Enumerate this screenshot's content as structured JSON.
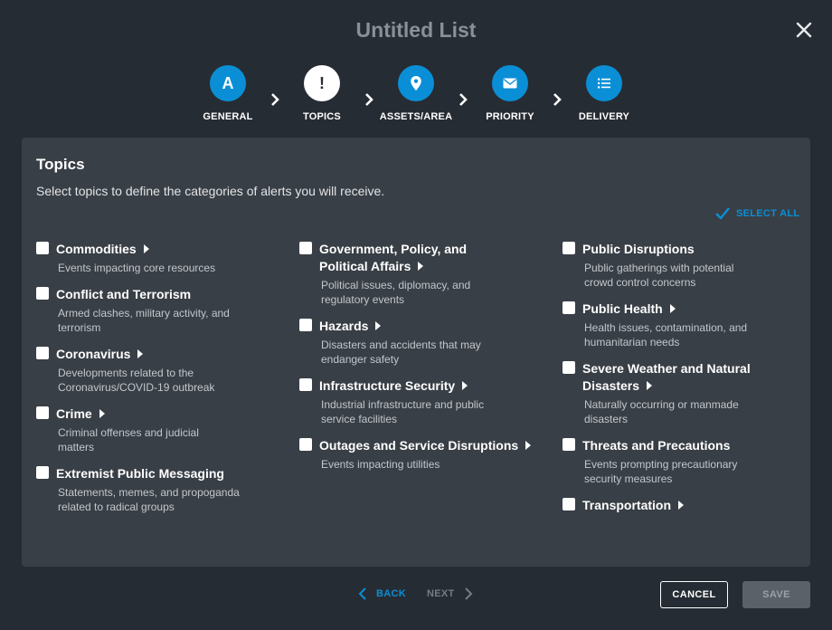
{
  "header": {
    "title": "Untitled List",
    "close_icon": "close-icon"
  },
  "steps": [
    {
      "label": "GENERAL",
      "icon": "A",
      "state": "complete"
    },
    {
      "label": "TOPICS",
      "icon": "!",
      "state": "active"
    },
    {
      "label": "ASSETS/AREA",
      "icon": "map-pin-icon",
      "state": "pending"
    },
    {
      "label": "PRIORITY",
      "icon": "envelope-icon",
      "state": "pending"
    },
    {
      "label": "DELIVERY",
      "icon": "list-icon",
      "state": "pending"
    }
  ],
  "panel": {
    "title": "Topics",
    "subtitle": "Select topics to define the categories of alerts you will receive.",
    "select_all": "SELECT ALL",
    "columns": [
      [
        {
          "name": "Commodities",
          "desc": "Events impacting core resources",
          "expandable": true
        },
        {
          "name": "Conflict and Terrorism",
          "desc": "Armed clashes, military activity, and terrorism",
          "expandable": false
        },
        {
          "name": "Coronavirus",
          "desc": "Developments related to the Coronavirus/COVID-19 outbreak",
          "expandable": true
        },
        {
          "name": "Crime",
          "desc": "Criminal offenses and judicial matters",
          "expandable": true
        },
        {
          "name": "Extremist Public Messaging",
          "desc": "Statements, memes, and propoganda related to radical groups",
          "expandable": false
        }
      ],
      [
        {
          "name": "Government, Policy, and Political Affairs",
          "desc": "Political issues, diplomacy, and regulatory events",
          "expandable": true
        },
        {
          "name": "Hazards",
          "desc": "Disasters and accidents that may endanger safety",
          "expandable": true
        },
        {
          "name": "Infrastructure Security",
          "desc": "Industrial infrastructure and public service facilities",
          "expandable": true
        },
        {
          "name": "Outages and Service Disruptions",
          "desc": "Events impacting utilities",
          "expandable": true
        }
      ],
      [
        {
          "name": "Public Disruptions",
          "desc": "Public gatherings with potential crowd control concerns",
          "expandable": false
        },
        {
          "name": "Public Health",
          "desc": "Health issues, contamination, and humanitarian needs",
          "expandable": true
        },
        {
          "name": "Severe Weather and Natural Disasters",
          "desc": "Naturally occurring or manmade disasters",
          "expandable": true
        },
        {
          "name": "Threats and Precautions",
          "desc": "Events prompting precautionary security measures",
          "expandable": false
        },
        {
          "name": "Transportation",
          "desc": "",
          "expandable": true
        }
      ]
    ]
  },
  "footer": {
    "back": "BACK",
    "next": "NEXT",
    "cancel": "CANCEL",
    "save": "SAVE"
  },
  "colors": {
    "background": "#262c33",
    "panel": "#393f46",
    "accent": "#0a8fd6",
    "title": "#8a9098"
  }
}
